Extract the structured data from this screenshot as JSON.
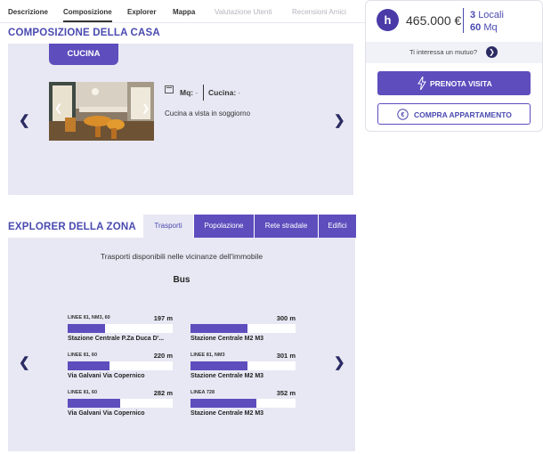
{
  "top_tabs": [
    "Descrizione",
    "Composizione",
    "Explorer",
    "Mappa",
    "Valutazione Utenti",
    "Recensioni Amici"
  ],
  "composizione": {
    "title": "COMPOSIZIONE DELLA CASA",
    "room_tab": "CUCINA",
    "mq_label": "Mq:",
    "mq_value": "-",
    "cucina_label": "Cucina:",
    "cucina_value": "-",
    "description": "Cucina a vista in soggiorno"
  },
  "explorer": {
    "title": "EXPLORER DELLA ZONA",
    "tabs": [
      "Trasporti",
      "Popolazione",
      "Rete stradale",
      "Edifici"
    ],
    "subtitle": "Trasporti disponibili nelle vicinanze dell'immobile",
    "category": "Bus",
    "stops": [
      {
        "lines": "LINEE 81, NM3, 60",
        "distance": "197 m",
        "name": "Stazione Centrale P.Za Duca D'...",
        "fill_fraction": 0.36
      },
      {
        "lines": "",
        "distance": "300 m",
        "name": "Stazione Centrale M2 M3",
        "fill_fraction": 0.54
      },
      {
        "lines": "LINEE 81, 60",
        "distance": "220 m",
        "name": "Via Galvani Via Copernico",
        "fill_fraction": 0.4
      },
      {
        "lines": "LINEE 81, NM3",
        "distance": "301 m",
        "name": "Stazione Centrale M2 M3",
        "fill_fraction": 0.54
      },
      {
        "lines": "LINEE 81, 60",
        "distance": "282 m",
        "name": "Via Galvani Via Copernico",
        "fill_fraction": 0.5
      },
      {
        "lines": "LINEA 728",
        "distance": "352 m",
        "name": "Stazione Centrale M2 M3",
        "fill_fraction": 0.63
      }
    ]
  },
  "price_card": {
    "logo_letter": "h",
    "price": "465.000 €",
    "locali_num": "3",
    "locali_label": "Locali",
    "mq_num": "60",
    "mq_label": "Mq",
    "mutuo_text": "Ti interessa un mutuo?",
    "prenota_label": "PRENOTA VISITA",
    "compra_label": "COMPRA APPARTAMENTO"
  },
  "icons": {
    "arrow_left": "chevron-left-icon",
    "arrow_right": "chevron-right-icon",
    "lightning": "lightning-icon",
    "euro": "euro-icon"
  },
  "colors": {
    "accent": "#5d4dbd",
    "heading": "#4a4ab0",
    "panel_bg": "#e8e8f4",
    "dark_navy": "#2b2b63"
  }
}
